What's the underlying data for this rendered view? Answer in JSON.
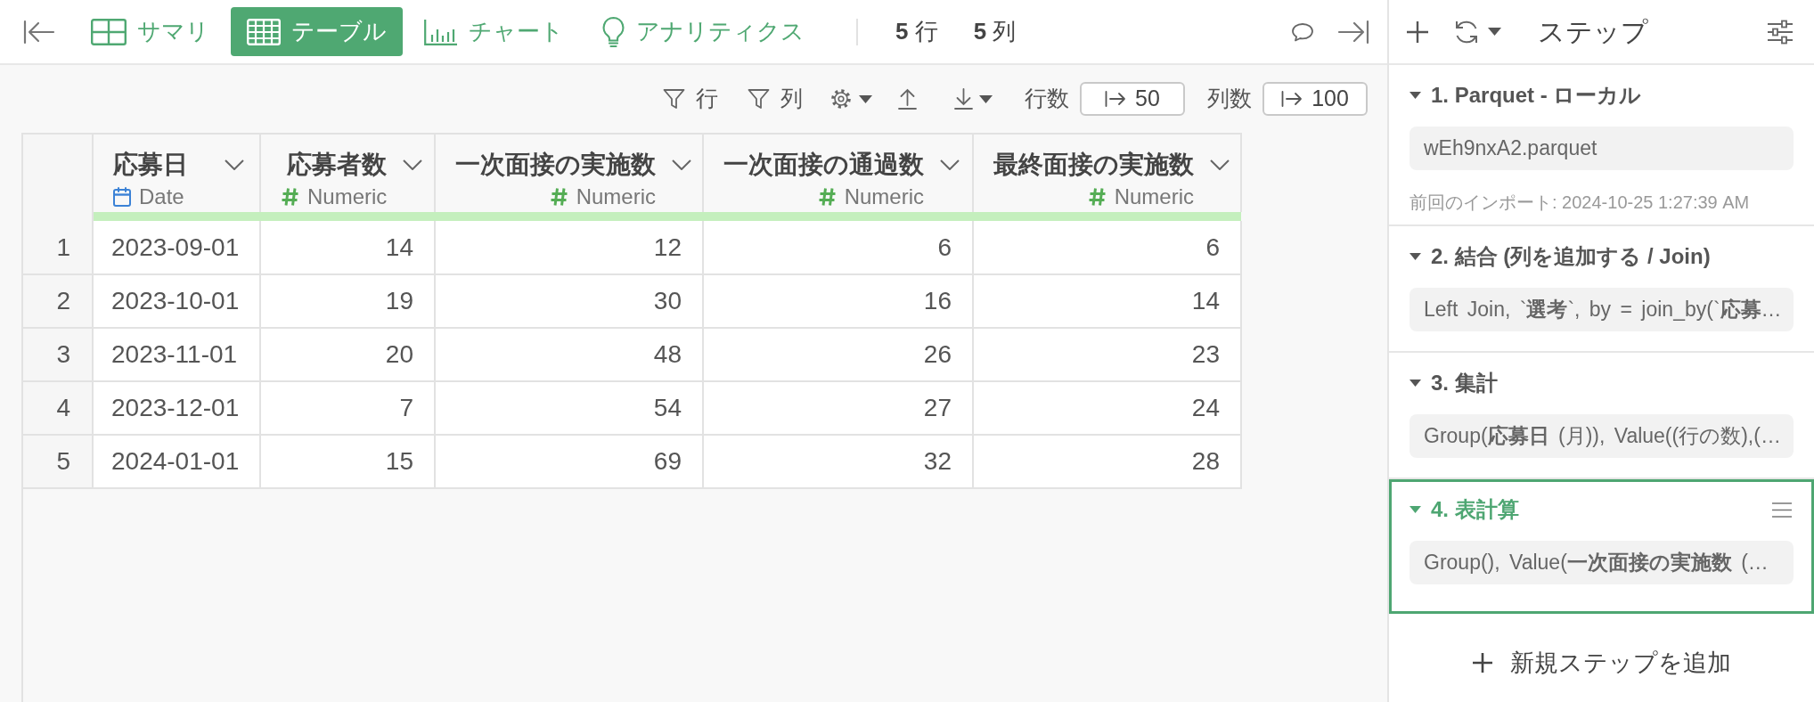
{
  "top_bar": {
    "tabs": [
      {
        "label": "サマリ",
        "selected": false
      },
      {
        "label": "テーブル",
        "selected": true
      },
      {
        "label": "チャート",
        "selected": false
      },
      {
        "label": "アナリティクス",
        "selected": false
      }
    ],
    "counts": [
      "**5** 行",
      "**5** 列"
    ]
  },
  "table_toolbar": {
    "filters": [
      "行",
      "列"
    ],
    "limits": [
      {
        "label": "行数",
        "value": "50"
      },
      {
        "label": "列数",
        "value": "100"
      }
    ]
  },
  "table": {
    "columns": [
      {
        "name": "応募日",
        "type": "Date",
        "kind": "date"
      },
      {
        "name": "応募者数",
        "type": "Numeric",
        "kind": "numeric"
      },
      {
        "name": "一次面接の実施数",
        "type": "Numeric",
        "kind": "numeric"
      },
      {
        "name": "一次面接の通過数",
        "type": "Numeric",
        "kind": "numeric"
      },
      {
        "name": "最終面接の実施数",
        "type": "Numeric",
        "kind": "numeric"
      }
    ],
    "rows": [
      {
        "number": "1",
        "cells": [
          "2023-09-01",
          "14",
          "12",
          "6",
          "6"
        ]
      },
      {
        "number": "2",
        "cells": [
          "2023-10-01",
          "19",
          "30",
          "16",
          "14"
        ]
      },
      {
        "number": "3",
        "cells": [
          "2023-11-01",
          "20",
          "48",
          "26",
          "23"
        ]
      },
      {
        "number": "4",
        "cells": [
          "2023-12-01",
          "7",
          "54",
          "27",
          "24"
        ]
      },
      {
        "number": "5",
        "cells": [
          "2024-01-01",
          "15",
          "69",
          "32",
          "28"
        ]
      }
    ]
  },
  "steps_panel": {
    "title": "ステップ",
    "steps": [
      {
        "title": "1. Parquet - ローカル",
        "summary": "wEh9nxA2.parquet",
        "note": "前回のインポート: 2024-10-25 1:27:39 AM",
        "expanded": true,
        "selected": false
      },
      {
        "title": "2. 結合 (列を追加する / Join)",
        "summary": "Left Join, `**選考**`, by = join_by(`**応募**…",
        "expanded": true,
        "selected": false
      },
      {
        "title": "3. 集計",
        "summary": "Group(**応募日** (月)), Value((行の数),(…",
        "expanded": true,
        "selected": false
      },
      {
        "title": "4. 表計算",
        "summary": "Group(), Value(**一次面接の実施数** (…",
        "expanded": true,
        "selected": true
      }
    ],
    "add_step": "新規ステップを追加"
  }
}
